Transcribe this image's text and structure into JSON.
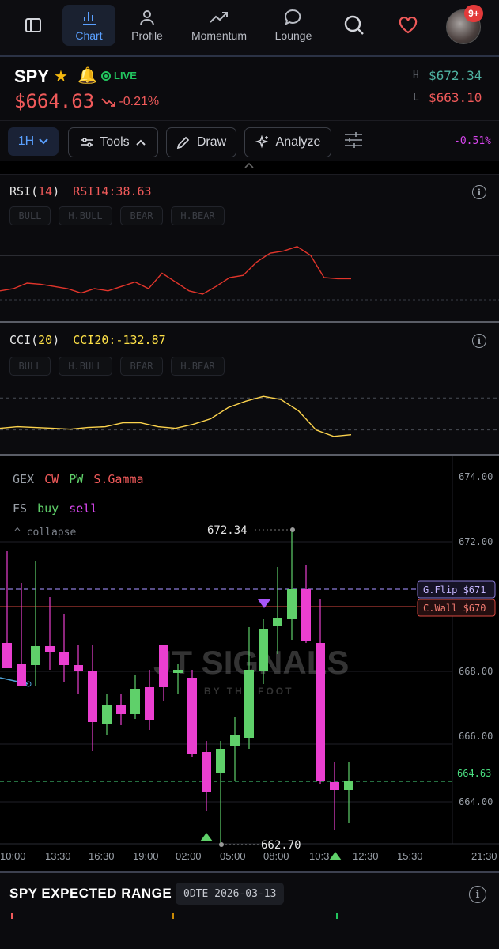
{
  "nav": {
    "items": [
      {
        "key": "chart",
        "label": "Chart",
        "icon": "bar-chart-icon"
      },
      {
        "key": "profile",
        "label": "Profile",
        "icon": "user-icon"
      },
      {
        "key": "momentum",
        "label": "Momentum",
        "icon": "trending-up-icon"
      },
      {
        "key": "lounge",
        "label": "Lounge",
        "icon": "chat-bubble-icon"
      }
    ],
    "notification_badge": "9+"
  },
  "ticker": {
    "symbol": "SPY",
    "live_label": "LIVE",
    "price": "$664.63",
    "change": "-0.21%",
    "high_label": "H",
    "high": "$672.34",
    "low_label": "L",
    "low": "$663.10"
  },
  "toolbar": {
    "timeframe": "1H",
    "tools_label": "Tools",
    "draw_label": "Draw",
    "analyze_label": "Analyze",
    "pct_change": "-0.51%"
  },
  "rsi": {
    "name": "RSI(",
    "period": "14",
    "close": ")",
    "value_label": "RSI14:38.63",
    "tags": [
      "BULL",
      "H.BULL",
      "BEAR",
      "H.BEAR"
    ],
    "color": "#e2352b"
  },
  "cci": {
    "name": "CCI(",
    "period": "20",
    "close": ")",
    "value_label": "CCI20:-132.87",
    "tags": [
      "BULL",
      "H.BULL",
      "BEAR",
      "H.BEAR"
    ],
    "color": "#fcd34d"
  },
  "main": {
    "legend": {
      "gex": "GEX",
      "cw": "CW",
      "pw": "PW",
      "sgamma": "S.Gamma",
      "fs": "FS",
      "buy": "buy",
      "sell": "sell",
      "collapse": "collapse"
    },
    "y_ticks": [
      "674.00",
      "672.00",
      "668.00",
      "666.00",
      "664.00"
    ],
    "current_price_label": "664.63",
    "gflip_label": "G.Flip $671",
    "cwall_label": "C.Wall $670",
    "high_marker": "672.34",
    "low_marker": "662.70",
    "x_ticks": [
      "10:00",
      "13:30",
      "16:30",
      "19:00",
      "02:00",
      "05:00",
      "08:00",
      "10:3",
      "12:30",
      "15:30",
      "21:30"
    ],
    "watermark_main": "JT SIGNALS",
    "watermark_sub": "BY THE FOOT",
    "colors": {
      "bull": "#5fd06a",
      "bear": "#ea3fd0",
      "gflip": "#a78bfa",
      "cwall": "#f05a5a",
      "current": "#4ade80"
    }
  },
  "expected_range": {
    "title": "SPY EXPECTED RANGE",
    "badge": "0DTE 2026-03-13"
  },
  "chart_data": {
    "type": "line",
    "x_range": [
      0,
      32
    ],
    "series": [
      {
        "name": "RSI14",
        "ylim": [
          10,
          90
        ],
        "values": [
          38,
          40,
          45,
          44,
          42,
          40,
          36,
          40,
          38,
          42,
          46,
          40,
          54,
          46,
          38,
          35,
          42,
          50,
          52,
          64,
          72,
          74,
          78,
          70,
          50,
          49,
          49
        ]
      },
      {
        "name": "CCI20",
        "ylim": [
          -250,
          200
        ],
        "values": [
          -90,
          -80,
          -85,
          -90,
          -95,
          -85,
          -80,
          -55,
          -55,
          -80,
          -90,
          -65,
          -30,
          40,
          80,
          110,
          90,
          20,
          -100,
          -140,
          -130
        ]
      }
    ]
  }
}
